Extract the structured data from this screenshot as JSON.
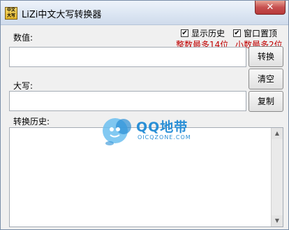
{
  "window": {
    "title": "LiZi中文大写转换器",
    "icon_text": "中文大写",
    "close_label": "✕"
  },
  "options": {
    "show_history": {
      "label": "显示历史",
      "checked": true
    },
    "window_on_top": {
      "label": "窗口置顶",
      "checked": true
    }
  },
  "limits": {
    "integer": "整数最多14位",
    "decimal": "小数最多2位"
  },
  "numeric": {
    "label": "数值:",
    "value": ""
  },
  "uppercase": {
    "label": "大写:",
    "value": ""
  },
  "buttons": {
    "convert": "转换",
    "clear": "清空",
    "copy": "复制"
  },
  "history": {
    "label": "转换历史:",
    "items": []
  },
  "watermark": {
    "title": "QQ地带",
    "subtitle": "OICQZONE.COM"
  },
  "colors": {
    "limit_text": "#c00000",
    "watermark": "#2a8fd6"
  }
}
